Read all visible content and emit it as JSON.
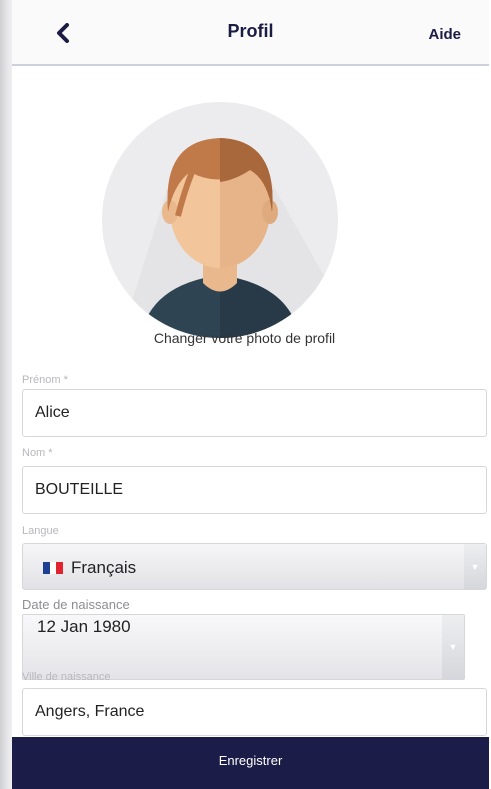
{
  "header": {
    "title": "Profil",
    "help_label": "Aide"
  },
  "avatar": {
    "caption": "Changer votre photo de profil"
  },
  "form": {
    "first_name": {
      "label": "Prénom *",
      "value": "Alice"
    },
    "last_name": {
      "label": "Nom *",
      "value": "BOUTEILLE"
    },
    "language": {
      "label": "Langue",
      "value": "Français",
      "icon": "french-flag-icon"
    },
    "birth_date": {
      "label": "Date de naissance",
      "value": "12 Jan 1980"
    },
    "birth_city": {
      "label": "Ville de naissance",
      "value": "Angers, France"
    }
  },
  "footer": {
    "save_label": "Enregistrer"
  },
  "colors": {
    "primary": "#1b1c48",
    "header_text": "#1b1c44",
    "label": "#b7b7bc"
  }
}
